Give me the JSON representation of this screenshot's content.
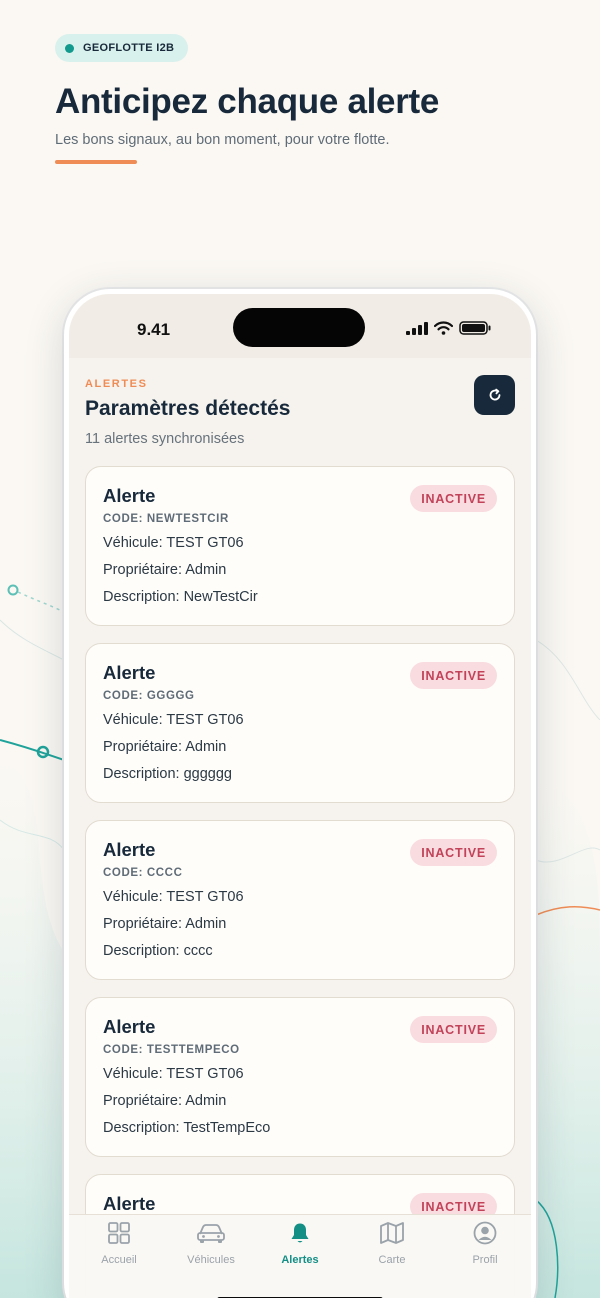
{
  "hero": {
    "badge": "GEOFLOTTE I2B",
    "title": "Anticipez chaque alerte",
    "subtitle": "Les bons signaux, au bon moment, pour votre flotte."
  },
  "status_bar": {
    "time": "9.41"
  },
  "header": {
    "kicker": "ALERTES",
    "title": "Paramètres détectés",
    "subtitle": "11 alertes synchronisées"
  },
  "alerts": [
    {
      "title": "Alerte",
      "code": "CODE: NEWTESTCIR",
      "status": "INACTIVE",
      "vehicle": "Véhicule: TEST GT06",
      "owner": "Propriétaire: Admin",
      "description": "Description: NewTestCir"
    },
    {
      "title": "Alerte",
      "code": "CODE: GGGGG",
      "status": "INACTIVE",
      "vehicle": "Véhicule: TEST GT06",
      "owner": "Propriétaire: Admin",
      "description": "Description: gggggg"
    },
    {
      "title": "Alerte",
      "code": "CODE: CCCC",
      "status": "INACTIVE",
      "vehicle": "Véhicule: TEST GT06",
      "owner": "Propriétaire: Admin",
      "description": "Description: cccc"
    },
    {
      "title": "Alerte",
      "code": "CODE: TESTTEMPECO",
      "status": "INACTIVE",
      "vehicle": "Véhicule: TEST GT06",
      "owner": "Propriétaire: Admin",
      "description": "Description: TestTempEco"
    },
    {
      "title": "Alerte",
      "status": "INACTIVE"
    }
  ],
  "tabs": [
    {
      "label": "Accueil",
      "icon": "grid-icon"
    },
    {
      "label": "Véhicules",
      "icon": "car-icon"
    },
    {
      "label": "Alertes",
      "icon": "bell-icon",
      "active": true
    },
    {
      "label": "Carte",
      "icon": "map-icon"
    },
    {
      "label": "Profil",
      "icon": "user-icon"
    }
  ],
  "colors": {
    "accent": "#148f86",
    "orange": "#ef8c55",
    "navy": "#17293a",
    "inactive_badge_bg": "#f9dce0",
    "inactive_badge_text": "#c24359"
  }
}
